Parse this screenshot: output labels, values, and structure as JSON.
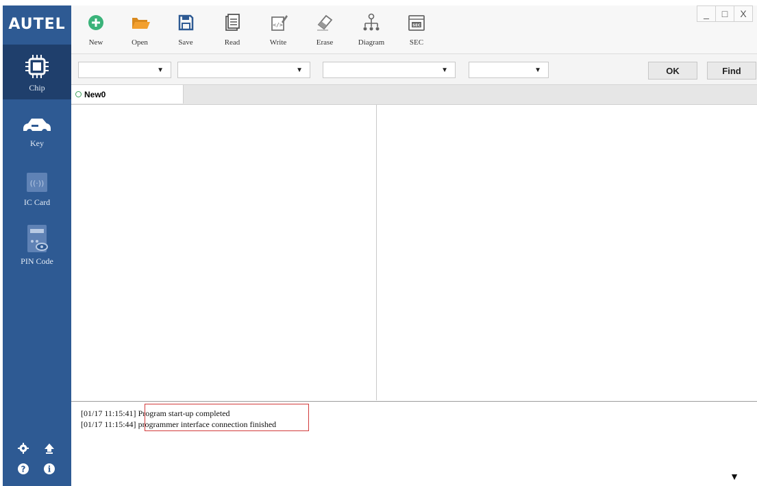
{
  "app": {
    "brand": "AUTEL"
  },
  "sidebar": {
    "items": [
      {
        "label": "Chip",
        "icon": "chip-icon",
        "active": true
      },
      {
        "label": "Key",
        "icon": "car-key-icon",
        "active": false
      },
      {
        "label": "IC Card",
        "icon": "ic-card-icon",
        "active": false
      },
      {
        "label": "PIN Code",
        "icon": "pin-code-icon",
        "active": false
      }
    ],
    "bottom_icons": [
      "gear-icon",
      "upload-icon",
      "help-icon",
      "info-icon"
    ]
  },
  "toolbar": {
    "buttons": [
      {
        "label": "New",
        "icon": "plus-circle-icon"
      },
      {
        "label": "Open",
        "icon": "folder-icon"
      },
      {
        "label": "Save",
        "icon": "save-icon"
      },
      {
        "label": "Read",
        "icon": "read-icon"
      },
      {
        "label": "Write",
        "icon": "write-icon"
      },
      {
        "label": "Erase",
        "icon": "eraser-icon"
      },
      {
        "label": "Diagram",
        "icon": "diagram-icon"
      },
      {
        "label": "SEC",
        "icon": "sec-icon"
      }
    ],
    "window_controls": {
      "minimize": "_",
      "maximize": "□",
      "close": "X"
    }
  },
  "filters": {
    "selects": [
      "",
      "",
      "",
      ""
    ],
    "ok_label": "OK",
    "find_label": "Find"
  },
  "tabs": [
    {
      "label": "New0"
    }
  ],
  "log": {
    "lines": [
      {
        "time": "[01/17 11:15:41]",
        "message": "Program start-up completed"
      },
      {
        "time": "[01/17 11:15:44]",
        "message": "programmer interface connection finished"
      }
    ]
  },
  "colors": {
    "sidebar": "#2e5a93",
    "sidebar_active": "#1f3f6c",
    "new_green": "#3bb37a",
    "folder_orange": "#f2a030",
    "highlight_red": "#d23a3a"
  }
}
